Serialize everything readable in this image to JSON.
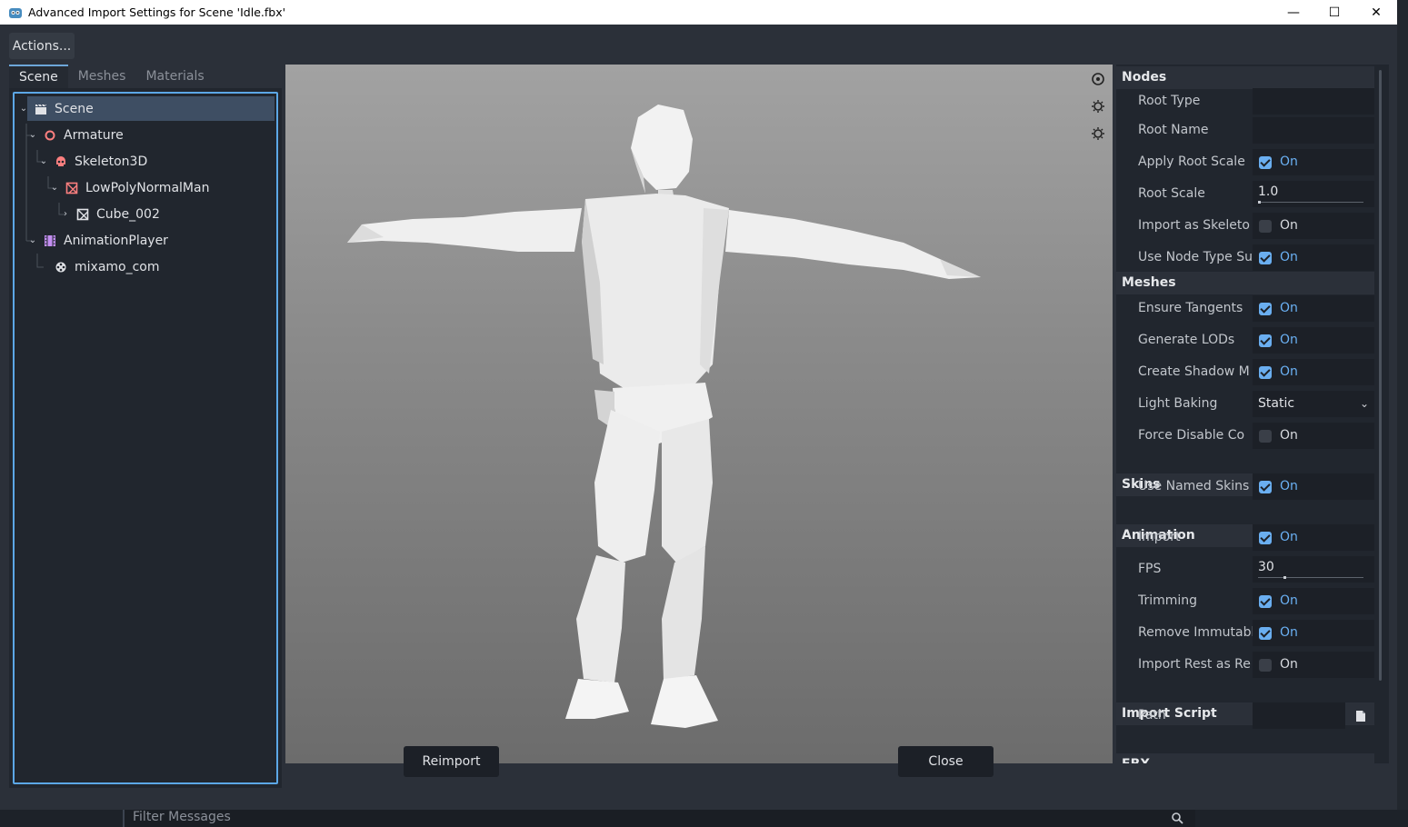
{
  "window": {
    "title": "Advanced Import Settings for Scene 'Idle.fbx'",
    "minimize_glyph": "—",
    "maximize_glyph": "☐",
    "close_glyph": "✕"
  },
  "toolbar": {
    "actions_label": "Actions..."
  },
  "tabs": [
    {
      "label": "Scene"
    },
    {
      "label": "Meshes"
    },
    {
      "label": "Materials"
    }
  ],
  "tree": {
    "nodes": [
      {
        "label": "Scene",
        "icon": "clapperboard-icon",
        "color": "#e0e2e6"
      },
      {
        "label": "Armature",
        "icon": "circle-node-icon",
        "color": "#fc7f7f"
      },
      {
        "label": "Skeleton3D",
        "icon": "skull-icon",
        "color": "#fc7f7f"
      },
      {
        "label": "LowPolyNormalMan",
        "icon": "mesh-instance-icon",
        "color": "#fc7f7f"
      },
      {
        "label": "Cube_002",
        "icon": "mesh-icon",
        "color": "#e0e2e6"
      },
      {
        "label": "AnimationPlayer",
        "icon": "film-icon",
        "color": "#c38ef1"
      },
      {
        "label": "mixamo_com",
        "icon": "animation-icon",
        "color": "#e0e2e6"
      }
    ]
  },
  "inspector": {
    "sections": {
      "nodes": "Nodes",
      "meshes": "Meshes",
      "skins": "Skins",
      "animation": "Animation",
      "import_script": "Import Script",
      "fbx": "FBX"
    },
    "props": {
      "root_type": {
        "label": "Root Type",
        "value": ""
      },
      "root_name": {
        "label": "Root Name",
        "value": ""
      },
      "apply_root_scale": {
        "label": "Apply Root Scale",
        "value": "On"
      },
      "root_scale": {
        "label": "Root Scale",
        "value": "1.0"
      },
      "import_as_skeleton": {
        "label": "Import as Skeleto",
        "value": "On"
      },
      "use_node_type_suffixes": {
        "label": "Use Node Type Su",
        "value": "On"
      },
      "ensure_tangents": {
        "label": "Ensure Tangents",
        "value": "On"
      },
      "generate_lods": {
        "label": "Generate LODs",
        "value": "On"
      },
      "create_shadow_meshes": {
        "label": "Create Shadow M",
        "value": "On"
      },
      "light_baking": {
        "label": "Light Baking",
        "value": "Static"
      },
      "force_disable_compression": {
        "label": "Force Disable Co",
        "value": "On"
      },
      "use_named_skins": {
        "label": "Use Named Skins",
        "value": "On"
      },
      "anim_import": {
        "label": "Import",
        "value": "On"
      },
      "fps": {
        "label": "FPS",
        "value": "30"
      },
      "trimming": {
        "label": "Trimming",
        "value": "On"
      },
      "remove_immutable_tracks": {
        "label": "Remove Immutabl",
        "value": "On"
      },
      "import_rest_as_reset": {
        "label": "Import Rest as Re",
        "value": "On"
      },
      "script_path": {
        "label": "Path",
        "value": ""
      }
    }
  },
  "buttons": {
    "reimport": "Reimport",
    "close": "Close"
  },
  "bottom": {
    "filter_placeholder": "Filter Messages"
  }
}
